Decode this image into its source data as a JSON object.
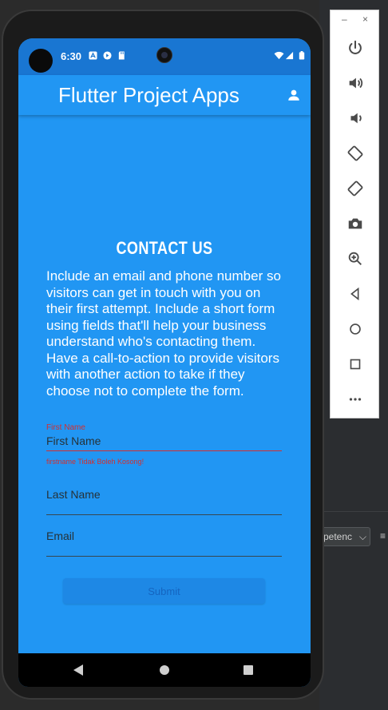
{
  "status_bar": {
    "time": "6:30"
  },
  "app_bar": {
    "title": "Flutter Project Apps",
    "action_icon": "person-icon"
  },
  "content": {
    "heading": "CONTACT US",
    "description": "Include an email and phone number so visitors can get in touch with you on their first attempt. Include a short form using fields that'll help your business understand who's contacting them. Have a call-to-action to provide visitors with another action to take if they choose not to complete the form."
  },
  "form": {
    "first_name": {
      "floating_label": "First Name",
      "placeholder": "First Name",
      "value": "",
      "error": "firstname Tidak Boleh Kosong!"
    },
    "last_name": {
      "placeholder": "Last Name",
      "value": ""
    },
    "email": {
      "placeholder": "Email",
      "value": ""
    },
    "submit_label": "Submit"
  },
  "emulator_toolbar": {
    "window_controls": [
      "–",
      "×"
    ],
    "buttons": [
      "power-icon",
      "volume-up-icon",
      "volume-down-icon",
      "rotate-left-icon",
      "rotate-right-icon",
      "camera-icon",
      "zoom-icon",
      "back-icon",
      "home-icon",
      "overview-icon",
      "more-icon"
    ]
  },
  "ide": {
    "dropdown_text": "petenc",
    "menu_glyph": "≡"
  },
  "colors": {
    "primary": "#2196f3",
    "primary_dark": "#1976d2",
    "error": "#d32f2f"
  }
}
